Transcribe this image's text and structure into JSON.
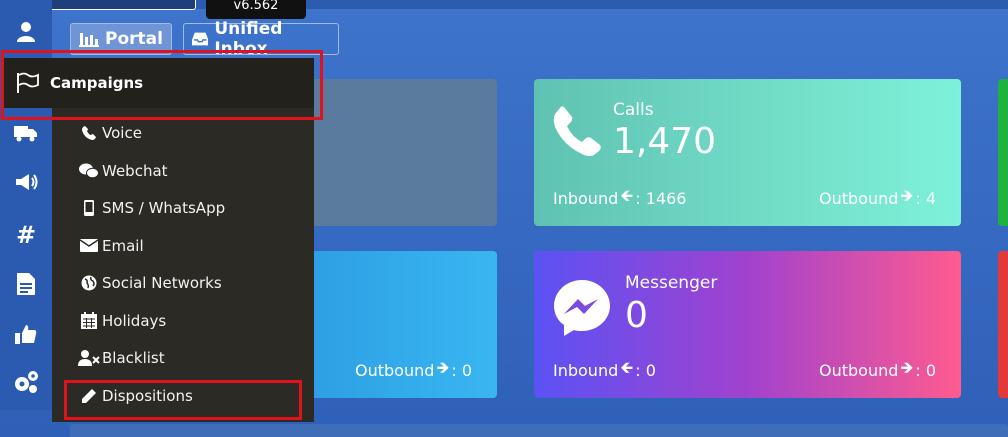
{
  "app": {
    "version": "v6.562"
  },
  "nav": {
    "portal_label": "Portal",
    "inbox_label": "Unified Inbox"
  },
  "rail": [
    {
      "icon": "user-icon"
    },
    {
      "icon": "truck-icon"
    },
    {
      "icon": "bullhorn-icon"
    },
    {
      "icon": "hashtag-icon"
    },
    {
      "icon": "document-icon"
    },
    {
      "icon": "thumbs-up-icon"
    },
    {
      "icon": "gears-icon"
    }
  ],
  "menu": {
    "header_label": "Campaigns",
    "items": [
      {
        "label": "Voice",
        "icon": "phone-icon"
      },
      {
        "label": "Webchat",
        "icon": "wechat-icon"
      },
      {
        "label": "SMS / WhatsApp",
        "icon": "mobile-icon"
      },
      {
        "label": "Email",
        "icon": "envelope-icon"
      },
      {
        "label": "Social Networks",
        "icon": "globe-icon"
      },
      {
        "label": "Holidays",
        "icon": "calendar-icon"
      },
      {
        "label": "Blacklist",
        "icon": "user-times-icon"
      },
      {
        "label": "Dispositions",
        "icon": "pencil-icon"
      }
    ]
  },
  "cards": {
    "calls": {
      "title": "Calls",
      "value": "1,470",
      "inbound_label": "Inbound",
      "inbound_value": ": 1466",
      "outbound_label": "Outbound",
      "outbound_value": ": 4"
    },
    "left_bottom": {
      "outbound_label": "Outbound",
      "outbound_value": ": 0"
    },
    "messenger": {
      "title": "Messenger",
      "value": "0",
      "inbound_label": "Inbound",
      "inbound_value": ": 0",
      "outbound_label": "Outbound",
      "outbound_value": ": 0"
    }
  },
  "colors": {
    "highlight": "#e0121b",
    "menu_bg": "#2b2a24",
    "calls_card": "#74dfc9",
    "messenger_start": "#5b52f4",
    "messenger_end": "#ff5b8f"
  }
}
